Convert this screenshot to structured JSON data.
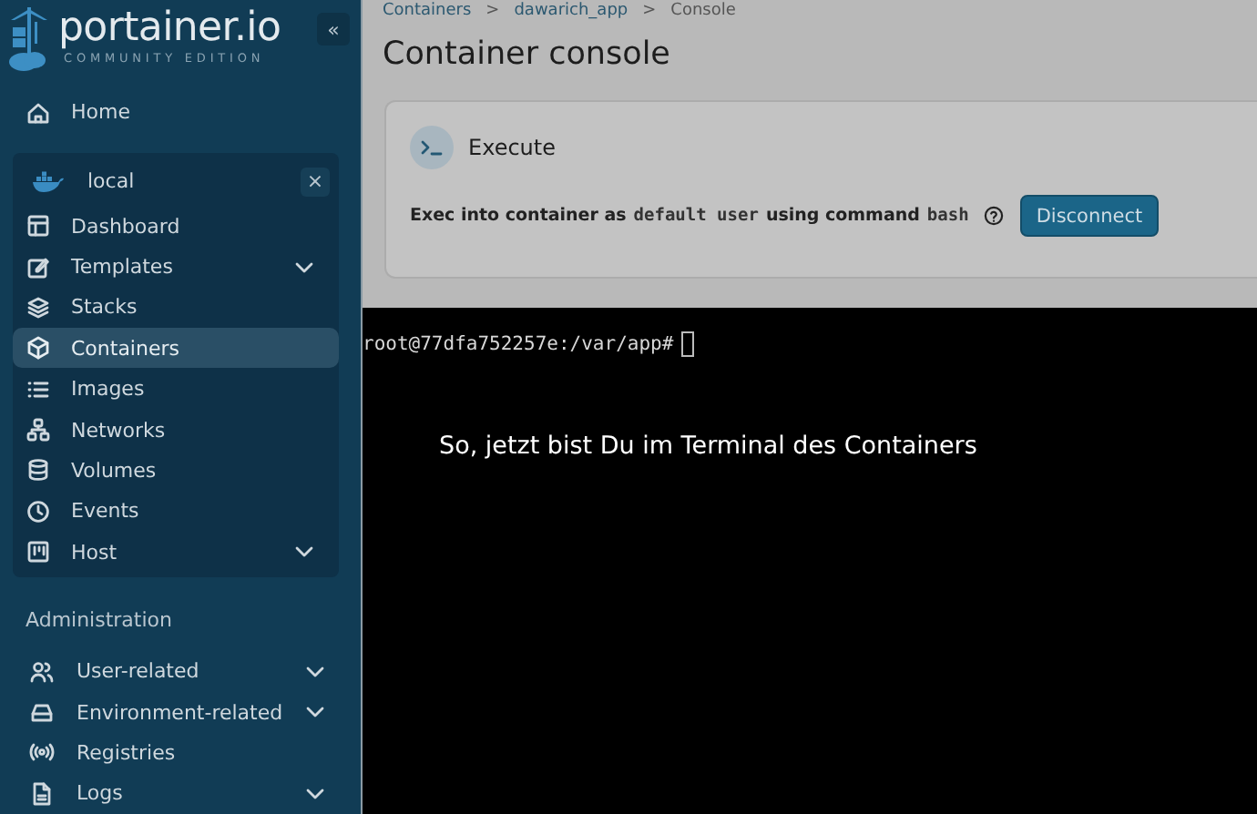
{
  "sidebar": {
    "logo": {
      "name": "portainer.io",
      "edition": "COMMUNITY EDITION"
    },
    "collapse_button": "«",
    "home": {
      "label": "Home",
      "selected": false
    },
    "environment": {
      "name": "local",
      "close": "×",
      "items": [
        {
          "label": "Dashboard",
          "selected": false,
          "expandable": false
        },
        {
          "label": "Templates",
          "selected": false,
          "expandable": true
        },
        {
          "label": "Stacks",
          "selected": false,
          "expandable": false
        },
        {
          "label": "Containers",
          "selected": true,
          "expandable": false
        },
        {
          "label": "Images",
          "selected": false,
          "expandable": false
        },
        {
          "label": "Networks",
          "selected": false,
          "expandable": false
        },
        {
          "label": "Volumes",
          "selected": false,
          "expandable": false
        },
        {
          "label": "Events",
          "selected": false,
          "expandable": false
        },
        {
          "label": "Host",
          "selected": false,
          "expandable": true
        }
      ]
    },
    "section_title": "Administration",
    "admin_items": [
      {
        "label": "User-related",
        "selected": false,
        "expandable": true
      },
      {
        "label": "Environment-related",
        "selected": false,
        "expandable": true
      },
      {
        "label": "Registries",
        "selected": false,
        "expandable": false
      },
      {
        "label": "Logs",
        "selected": false,
        "expandable": true
      }
    ]
  },
  "breadcrumb": [
    {
      "label": "Containers",
      "link": true
    },
    {
      "label": "dawarich_app",
      "link": true
    },
    {
      "label": "Console",
      "link": false
    }
  ],
  "breadcrumb_separator": ">",
  "page_title": "Container console",
  "execute_card": {
    "title": "Execute",
    "exec_parts": [
      {
        "text": "Exec into container as",
        "code": false
      },
      {
        "text": "default user",
        "code": true
      },
      {
        "text": "using command",
        "code": false
      },
      {
        "text": "bash",
        "code": true
      }
    ],
    "button": "Disconnect"
  },
  "terminal": {
    "prompt": "root@77dfa752257e:/var/app#"
  },
  "annotation": "So, jetzt bist Du im Terminal des Containers"
}
